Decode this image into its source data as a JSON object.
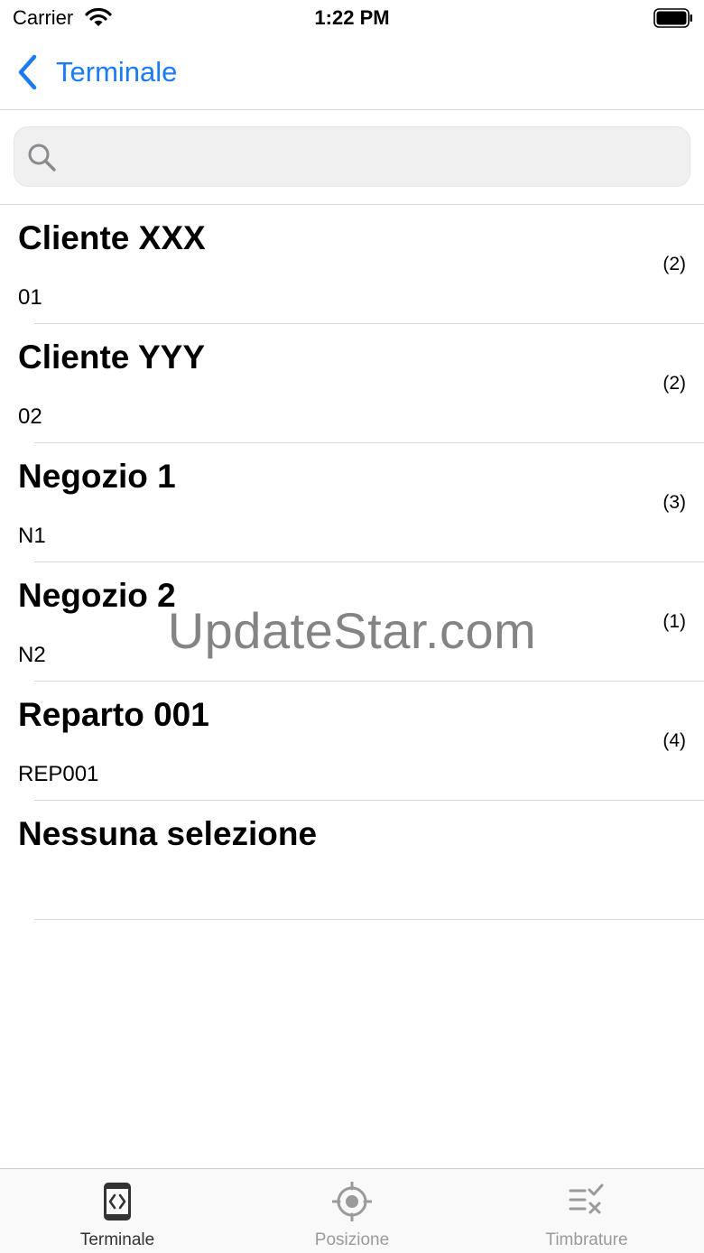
{
  "status_bar": {
    "carrier": "Carrier",
    "time": "1:22 PM"
  },
  "nav": {
    "back_label": "Terminale"
  },
  "search": {
    "value": "",
    "placeholder": ""
  },
  "items": [
    {
      "title": "Cliente XXX",
      "code": "01",
      "count": "(2)"
    },
    {
      "title": "Cliente YYY",
      "code": "02",
      "count": "(2)"
    },
    {
      "title": "Negozio 1",
      "code": "N1",
      "count": "(3)"
    },
    {
      "title": "Negozio 2",
      "code": "N2",
      "count": "(1)"
    },
    {
      "title": "Reparto 001",
      "code": "REP001",
      "count": "(4)"
    },
    {
      "title": "Nessuna selezione",
      "code": "",
      "count": ""
    }
  ],
  "watermark": "UpdateStar.com",
  "tabs": [
    {
      "label": "Terminale",
      "icon": "terminal-icon",
      "active": true
    },
    {
      "label": "Posizione",
      "icon": "location-target-icon",
      "active": false
    },
    {
      "label": "Timbrature",
      "icon": "list-check-icon",
      "active": false
    }
  ],
  "colors": {
    "accent": "#1a7cf5",
    "tab_active": "#333333",
    "tab_inactive": "#9a9a9a"
  }
}
